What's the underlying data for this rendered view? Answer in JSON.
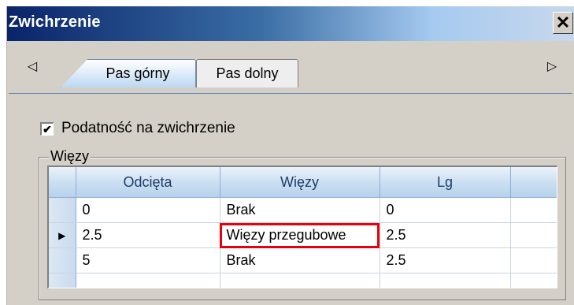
{
  "window": {
    "title": "Zwichrzenie",
    "close_glyph": "✕"
  },
  "tabs": {
    "scroll_left_glyph": "◁",
    "scroll_right_glyph": "▷",
    "items": [
      {
        "label": "Pas górny",
        "active": true
      },
      {
        "label": "Pas dolny",
        "active": false
      }
    ]
  },
  "options": {
    "buckling_label": "Podatność na zwichrzenie",
    "buckling_checked": true,
    "check_glyph": "✔"
  },
  "constraints": {
    "group_label": "Więzy",
    "columns": [
      "Odcięta",
      "Więzy",
      "Lg"
    ],
    "current_row_indicator": "▶",
    "rows": [
      {
        "odcieta": "0",
        "wiezy": "Brak",
        "lg": "0",
        "current": false
      },
      {
        "odcieta": "2.5",
        "wiezy": "Więzy przegubowe",
        "lg": "2.5",
        "current": true
      },
      {
        "odcieta": "5",
        "wiezy": "Brak",
        "lg": "2.5",
        "current": false
      }
    ]
  },
  "colors": {
    "title_gradient_start": "#0a246a",
    "selection_outline": "#e8000b",
    "header_text": "#1f3d66"
  }
}
